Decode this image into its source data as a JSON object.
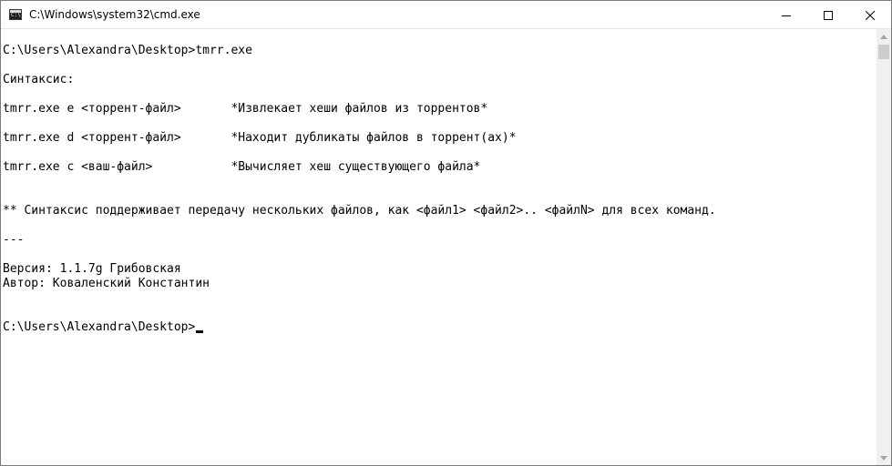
{
  "window": {
    "title": "C:\\Windows\\system32\\cmd.exe",
    "icon_name": "cmd-icon",
    "icon_text": "C:\\",
    "controls": {
      "minimize": "minimize-icon",
      "maximize": "maximize-icon",
      "close": "close-icon"
    }
  },
  "console": {
    "lines": [
      "C:\\Users\\Alexandra\\Desktop>tmrr.exe",
      "",
      "Синтаксис:",
      "",
      "tmrr.exe e <торрент-файл>       *Извлекает хеши файлов из торрентов*",
      "",
      "tmrr.exe d <торрент-файл>       *Находит дубликаты файлов в торрент(ах)*",
      "",
      "tmrr.exe c <ваш-файл>           *Вычисляет хеш существующего файла*",
      "",
      "",
      "** Синтаксис поддерживает передачу нескольких файлов, как <файл1> <файл2>.. <файлN> для всех команд.",
      "",
      "---",
      "",
      "Версия: 1.1.7g Грибовская",
      "Автор: Коваленский Константин",
      "",
      "",
      "C:\\Users\\Alexandra\\Desktop>"
    ]
  },
  "colors": {
    "background": "#ffffff",
    "text": "#000000",
    "scrollbar_track": "#f0f0f0",
    "scrollbar_thumb": "#cdcdcd"
  }
}
